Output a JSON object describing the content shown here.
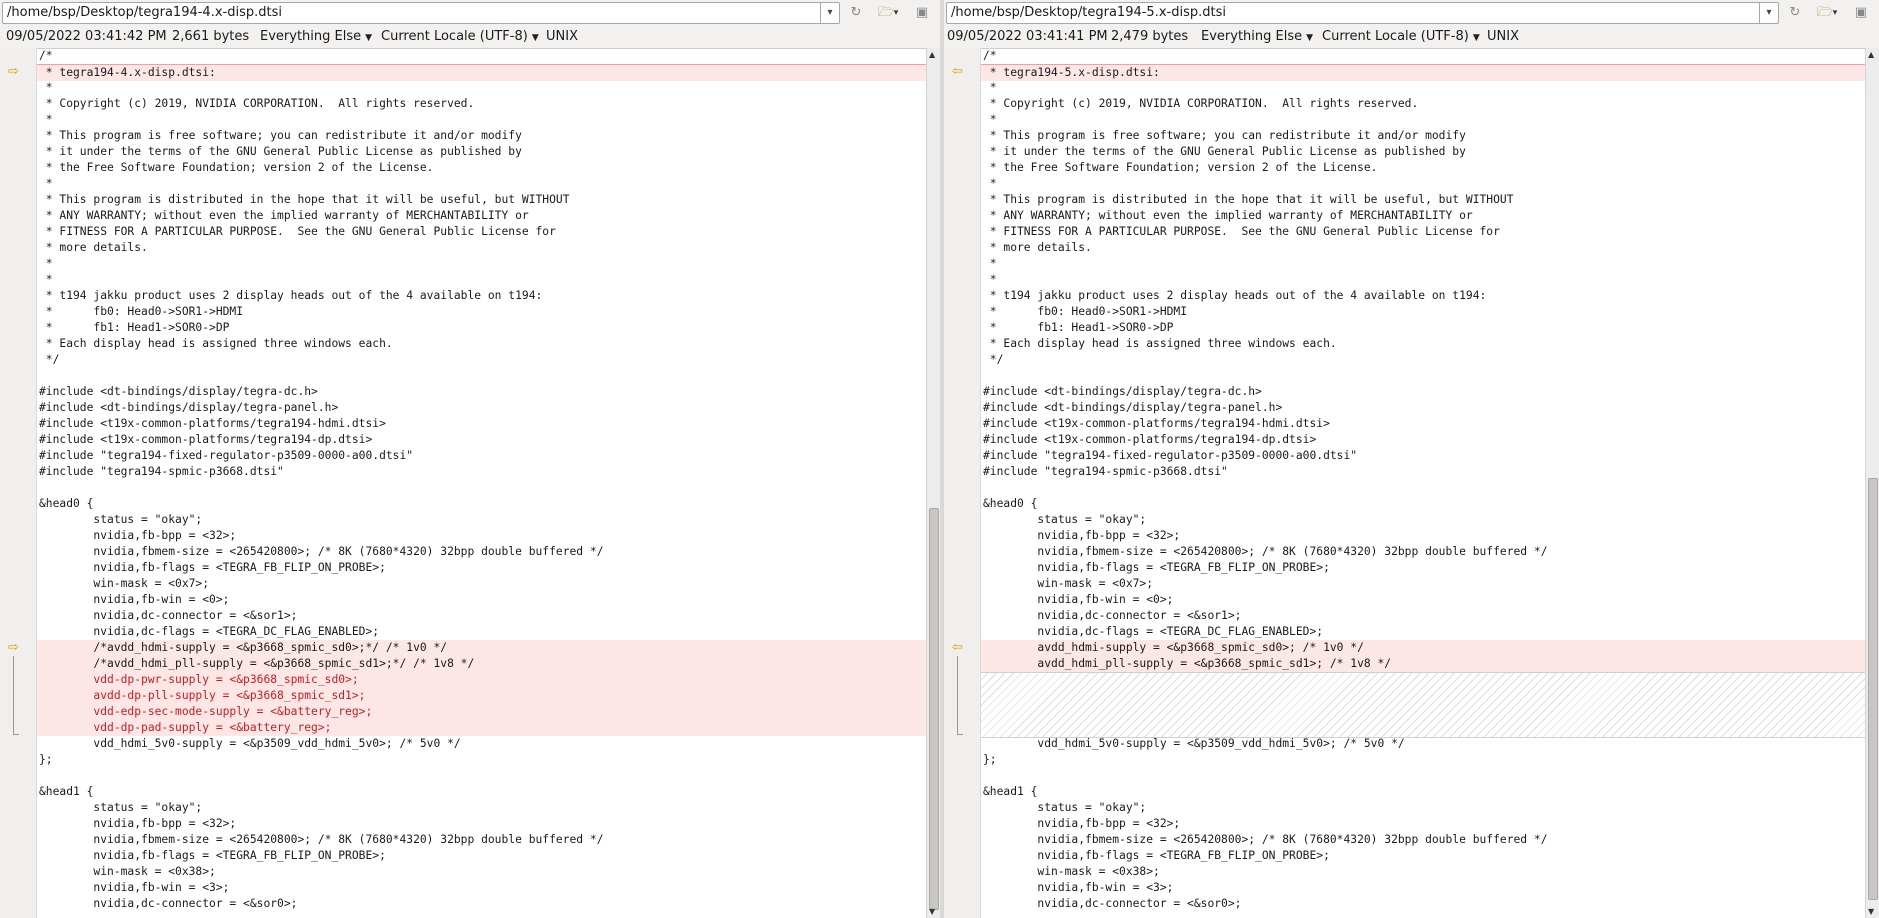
{
  "left": {
    "path": "/home/bsp/Desktop/tegra194-4.x-disp.dtsi",
    "timestamp": "09/05/2022 03:41:42 PM",
    "size": "2,661 bytes",
    "syntax": "Everything Else",
    "encoding": "Current Locale (UTF-8)",
    "line_ending": "UNIX",
    "lines": [
      "/*",
      " * tegra194-4.x-disp.dtsi:",
      " *",
      " * Copyright (c) 2019, NVIDIA CORPORATION.  All rights reserved.",
      " *",
      " * This program is free software; you can redistribute it and/or modify",
      " * it under the terms of the GNU General Public License as published by",
      " * the Free Software Foundation; version 2 of the License.",
      " *",
      " * This program is distributed in the hope that it will be useful, but WITHOUT",
      " * ANY WARRANTY; without even the implied warranty of MERCHANTABILITY or",
      " * FITNESS FOR A PARTICULAR PURPOSE.  See the GNU General Public License for",
      " * more details.",
      " *",
      " *",
      " * t194 jakku product uses 2 display heads out of the 4 available on t194:",
      " *      fb0: Head0->SOR1->HDMI",
      " *      fb1: Head1->SOR0->DP",
      " * Each display head is assigned three windows each.",
      " */",
      "",
      "#include <dt-bindings/display/tegra-dc.h>",
      "#include <dt-bindings/display/tegra-panel.h>",
      "#include <t19x-common-platforms/tegra194-hdmi.dtsi>",
      "#include <t19x-common-platforms/tegra194-dp.dtsi>",
      "#include \"tegra194-fixed-regulator-p3509-0000-a00.dtsi\"",
      "#include \"tegra194-spmic-p3668.dtsi\"",
      "",
      "&head0 {",
      "        status = \"okay\";",
      "        nvidia,fb-bpp = <32>;",
      "        nvidia,fbmem-size = <265420800>; /* 8K (7680*4320) 32bpp double buffered */",
      "        nvidia,fb-flags = <TEGRA_FB_FLIP_ON_PROBE>;",
      "        win-mask = <0x7>;",
      "        nvidia,fb-win = <0>;",
      "        nvidia,dc-connector = <&sor1>;",
      "        nvidia,dc-flags = <TEGRA_DC_FLAG_ENABLED>;",
      "        /*avdd_hdmi-supply = <&p3668_spmic_sd0>;*/ /* 1v0 */",
      "        /*avdd_hdmi_pll-supply = <&p3668_spmic_sd1>;*/ /* 1v8 */",
      "        vdd-dp-pwr-supply = <&p3668_spmic_sd0>;",
      "        avdd-dp-pll-supply = <&p3668_spmic_sd1>;",
      "        vdd-edp-sec-mode-supply = <&battery_reg>;",
      "        vdd-dp-pad-supply = <&battery_reg>;",
      "        vdd_hdmi_5v0-supply = <&p3509_vdd_hdmi_5v0>; /* 5v0 */",
      "};",
      "",
      "&head1 {",
      "        status = \"okay\";",
      "        nvidia,fb-bpp = <32>;",
      "        nvidia,fbmem-size = <265420800>; /* 8K (7680*4320) 32bpp double buffered */",
      "        nvidia,fb-flags = <TEGRA_FB_FLIP_ON_PROBE>;",
      "        win-mask = <0x38>;",
      "        nvidia,fb-win = <3>;",
      "        nvidia,dc-connector = <&sor0>;"
    ]
  },
  "right": {
    "path": "/home/bsp/Desktop/tegra194-5.x-disp.dtsi",
    "timestamp": "09/05/2022 03:41:41 PM",
    "size": "2,479 bytes",
    "syntax": "Everything Else",
    "encoding": "Current Locale (UTF-8)",
    "line_ending": "UNIX",
    "lines": [
      "/*",
      " * tegra194-5.x-disp.dtsi:",
      " *",
      " * Copyright (c) 2019, NVIDIA CORPORATION.  All rights reserved.",
      " *",
      " * This program is free software; you can redistribute it and/or modify",
      " * it under the terms of the GNU General Public License as published by",
      " * the Free Software Foundation; version 2 of the License.",
      " *",
      " * This program is distributed in the hope that it will be useful, but WITHOUT",
      " * ANY WARRANTY; without even the implied warranty of MERCHANTABILITY or",
      " * FITNESS FOR A PARTICULAR PURPOSE.  See the GNU General Public License for",
      " * more details.",
      " *",
      " *",
      " * t194 jakku product uses 2 display heads out of the 4 available on t194:",
      " *      fb0: Head0->SOR1->HDMI",
      " *      fb1: Head1->SOR0->DP",
      " * Each display head is assigned three windows each.",
      " */",
      "",
      "#include <dt-bindings/display/tegra-dc.h>",
      "#include <dt-bindings/display/tegra-panel.h>",
      "#include <t19x-common-platforms/tegra194-hdmi.dtsi>",
      "#include <t19x-common-platforms/tegra194-dp.dtsi>",
      "#include \"tegra194-fixed-regulator-p3509-0000-a00.dtsi\"",
      "#include \"tegra194-spmic-p3668.dtsi\"",
      "",
      "&head0 {",
      "        status = \"okay\";",
      "        nvidia,fb-bpp = <32>;",
      "        nvidia,fbmem-size = <265420800>; /* 8K (7680*4320) 32bpp double buffered */",
      "        nvidia,fb-flags = <TEGRA_FB_FLIP_ON_PROBE>;",
      "        win-mask = <0x7>;",
      "        nvidia,fb-win = <0>;",
      "        nvidia,dc-connector = <&sor1>;",
      "        nvidia,dc-flags = <TEGRA_DC_FLAG_ENABLED>;",
      "        avdd_hdmi-supply = <&p3668_spmic_sd0>; /* 1v0 */",
      "        avdd_hdmi_pll-supply = <&p3668_spmic_sd1>; /* 1v8 */",
      "",
      "",
      "",
      "",
      "        vdd_hdmi_5v0-supply = <&p3509_vdd_hdmi_5v0>; /* 5v0 */",
      "};",
      "",
      "&head1 {",
      "        status = \"okay\";",
      "        nvidia,fb-bpp = <32>;",
      "        nvidia,fbmem-size = <265420800>; /* 8K (7680*4320) 32bpp double buffered */",
      "        nvidia,fb-flags = <TEGRA_FB_FLIP_ON_PROBE>;",
      "        win-mask = <0x38>;",
      "        nvidia,fb-win = <3>;",
      "        nvidia,dc-connector = <&sor0>;"
    ]
  },
  "icons": {
    "path_dropdown": "chevron-down-icon",
    "refresh": "refresh-icon",
    "open_folder": "folder-open-icon",
    "save": "save-icon",
    "diff_arrow_left": "arrow-right-icon",
    "diff_arrow_right": "arrow-left-icon"
  },
  "colors": {
    "diff_background": "#fde6e6",
    "diff_text": "#c81e1e",
    "marker": "#d4a400"
  }
}
